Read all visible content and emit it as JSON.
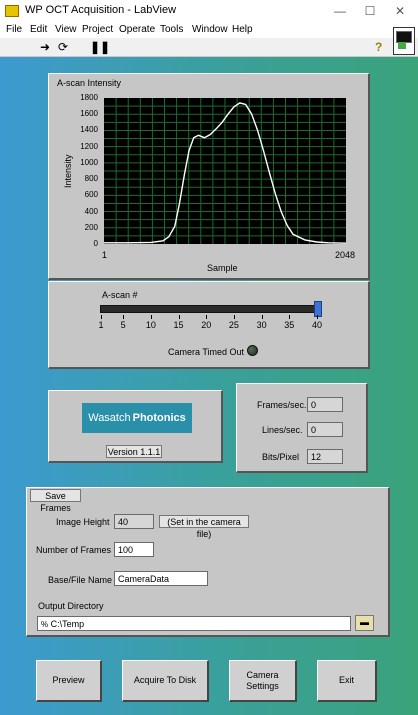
{
  "window": {
    "title": "WP OCT Acquisition - LabView",
    "minimize": "—",
    "maximize": "☐",
    "close": "✕"
  },
  "menu": [
    "File",
    "Edit",
    "View",
    "Project",
    "Operate",
    "Tools",
    "Window",
    "Help"
  ],
  "toolbar": {
    "run_icon": "run-arrow-icon",
    "continuous_icon": "run-continuous-icon",
    "pause_icon": "pause-icon",
    "help_icon": "help-icon"
  },
  "plot": {
    "title": "A-scan Intensity",
    "ylabel": "Intensity",
    "xlabel": "Sample",
    "yticks": [
      "1800",
      "1600",
      "1400",
      "1200",
      "1000",
      "800",
      "600",
      "400",
      "200",
      "0"
    ],
    "xticks": [
      "1",
      "2048"
    ]
  },
  "chart_data": {
    "type": "line",
    "title": "A-scan Intensity",
    "xlabel": "Sample",
    "ylabel": "Intensity",
    "xlim": [
      1,
      2048
    ],
    "ylim": [
      0,
      1800
    ],
    "grid": true,
    "series": [
      {
        "x": [
          1,
          200,
          400,
          500,
          550,
          600,
          640,
          680,
          720,
          760,
          800,
          850,
          900,
          950,
          1000,
          1050,
          1100,
          1150,
          1200,
          1250,
          1300,
          1350,
          1400,
          1450,
          1500,
          1550,
          1600,
          1700,
          1800,
          1900,
          2048
        ],
        "values": [
          15,
          15,
          20,
          40,
          90,
          220,
          500,
          850,
          1150,
          1310,
          1340,
          1310,
          1350,
          1420,
          1500,
          1600,
          1690,
          1740,
          1720,
          1600,
          1400,
          1150,
          880,
          620,
          400,
          230,
          120,
          50,
          25,
          15,
          10
        ]
      }
    ]
  },
  "slider": {
    "label": "A-scan #",
    "ticks": [
      "1",
      "5",
      "10",
      "15",
      "20",
      "25",
      "30",
      "35",
      "40"
    ],
    "value": 40,
    "min": 1,
    "max": 40
  },
  "camera_status": {
    "label": "Camera Timed Out"
  },
  "logo": {
    "word1": "Wasatch",
    "word2": "Photonics",
    "version": "Version 1.1.1"
  },
  "stats": {
    "frames_label": "Frames/sec.",
    "frames_value": "0",
    "lines_label": "Lines/sec.",
    "lines_value": "0",
    "bits_label": "Bits/Pixel",
    "bits_value": "12"
  },
  "save": {
    "header": "Save Frames",
    "height_label": "Image Height",
    "height_value": "40",
    "height_note": "(Set in the camera file)",
    "frames_label": "Number of Frames",
    "frames_value": "100",
    "base_label": "Base/File Name",
    "base_value": "CameraData",
    "dir_label": "Output Directory",
    "dir_value": "C:\\Temp"
  },
  "buttons": {
    "preview": "Preview",
    "acquire": "Acquire To Disk",
    "camera_line1": "Camera",
    "camera_line2": "Settings",
    "exit": "Exit"
  }
}
